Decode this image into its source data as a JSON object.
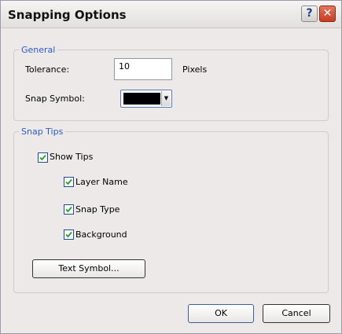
{
  "window": {
    "title": "Snapping Options",
    "help_glyph": "?",
    "close_glyph": "✕"
  },
  "general": {
    "legend": "General",
    "tolerance_label": "Tolerance:",
    "tolerance_value": "10",
    "tolerance_unit": "Pixels",
    "snap_symbol_label": "Snap Symbol:",
    "snap_symbol_color": "#000000"
  },
  "snap_tips": {
    "legend": "Snap Tips",
    "show_tips": {
      "label": "Show Tips",
      "checked": true
    },
    "layer_name": {
      "label": "Layer Name",
      "checked": true
    },
    "snap_type": {
      "label": "Snap Type",
      "checked": true
    },
    "background": {
      "label": "Background",
      "checked": true
    },
    "text_symbol_button": "Text Symbol..."
  },
  "footer": {
    "ok_label": "OK",
    "cancel_label": "Cancel"
  },
  "colors": {
    "legend_text": "#2e5bbf",
    "dialog_background": "#ece9e8",
    "check_mark": "#21a121"
  }
}
